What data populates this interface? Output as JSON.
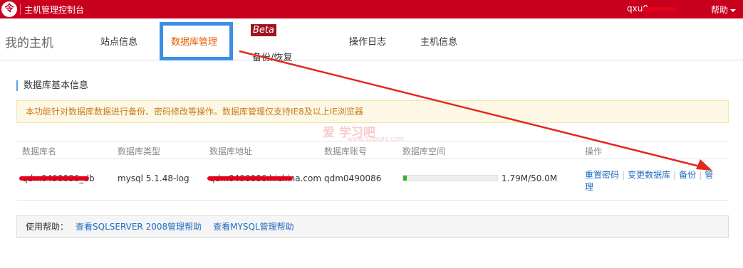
{
  "topbar": {
    "logo_glyph": "令",
    "title": "主机管理控制台",
    "user_label": "qxu0",
    "help_label": "帮助"
  },
  "nav": {
    "my_host": "我的主机",
    "tabs": {
      "site_info": "站点信息",
      "db_manage": "数据库管理",
      "beta": "Beta",
      "backup_restore": "备份/恢复",
      "op_log": "操作日志",
      "host_info": "主机信息"
    }
  },
  "section": {
    "title": "数据库基本信息",
    "notice": "本功能针对数据库数据进行备份、密码修改等操作。数据库管理仅支持IE8及以上IE浏览器"
  },
  "watermark": {
    "text": "爱 学习吧",
    "sub": "www.52pojie.com"
  },
  "table": {
    "headers": {
      "name": "数据库名",
      "type": "数据库类型",
      "address": "数据库地址",
      "account": "数据库账号",
      "space": "数据库空间",
      "ops": "操作"
    },
    "row": {
      "name": "qdm0490086_db",
      "type": "mysql 5.1.48-log",
      "address": "qdm0490086.hichina.com",
      "account": "qdm0490086",
      "space_label": "1.79M/50.0M",
      "space_fraction": 0.0358
    },
    "ops": {
      "reset_password": "重置密码",
      "change_db": "变更数据库",
      "backup": "备份",
      "manage": "管理"
    }
  },
  "help": {
    "label": "使用帮助：",
    "link_sqlserver": "查看SQLSERVER 2008管理帮助",
    "link_mysql": "查看MYSQL管理帮助"
  },
  "colors": {
    "brand_red": "#c8001e",
    "tab_highlight": "#3a8ee6",
    "link_blue": "#1f6bc2",
    "annotation_red": "#e3291f",
    "progress_green": "#3cb034"
  }
}
